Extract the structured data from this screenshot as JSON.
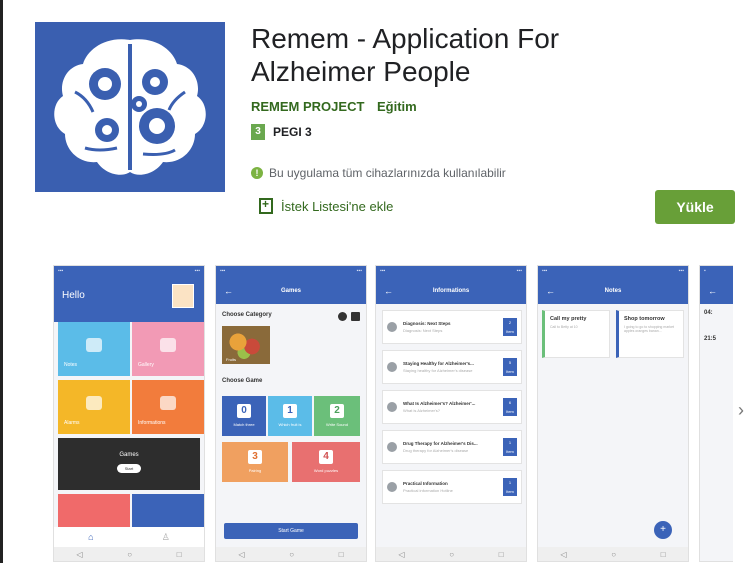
{
  "app": {
    "title": "Remem - Application For Alzheimer People",
    "developer": "REMEM PROJECT",
    "category": "Eğitim",
    "rating_badge": "3",
    "rating_label": "PEGI 3",
    "compatibility": "Bu uygulama tüm cihazlarınızda kullanılabilir",
    "wishlist_label": "İstek Listesi'ne ekle",
    "install_label": "Yükle",
    "icon": "brain-gears-icon"
  },
  "colors": {
    "accent_green": "#689f38",
    "text_green": "#33691e",
    "icon_blue": "#3a5fb0",
    "app_blue": "#3b63b8"
  },
  "screenshots": {
    "home": {
      "greeting": "Hello",
      "tiles": [
        "Notes",
        "Gallery",
        "Alarms",
        "Informations"
      ],
      "games_label": "Games",
      "start_label": "Start"
    },
    "games": {
      "title": "Games",
      "choose_category": "Choose Category",
      "category_label": "Fruits",
      "choose_game": "Choose Game",
      "game_numbers": [
        "0",
        "1",
        "2",
        "3",
        "4"
      ],
      "game_names": [
        "Match three",
        "Which fruit is",
        "Write Sound",
        "Pairing",
        "Word puzzles"
      ],
      "start_game": "Start Game"
    },
    "informations": {
      "title": "Informations",
      "rows": [
        {
          "title": "Diagnosis: Next Steps",
          "subtitle": "Diagnosis: Next Steps",
          "count": "2"
        },
        {
          "title": "Staying Healthy for Alzheimer's...",
          "subtitle": "Staying healthy for Alzheimer's disease",
          "count": "5"
        },
        {
          "title": "What Is Alzheimer's? Alzheimer'...",
          "subtitle": "What is Alzheimer's?",
          "count": "6"
        },
        {
          "title": "Drug Therapy for Alzheimer's Dis...",
          "subtitle": "Drug therapy for Alzheimer's disease",
          "count": "1"
        },
        {
          "title": "Practical Information",
          "subtitle": "Practical information Hotline",
          "count": "1"
        }
      ],
      "count_unit": "Item"
    },
    "notes": {
      "title": "Notes",
      "cards": [
        {
          "title": "Call my pretty",
          "body": "Call to Betty at 10"
        },
        {
          "title": "Shop tomorrow",
          "body": "I going to go to shopping market apples oranges banan..."
        }
      ]
    },
    "partial": {
      "items": [
        "04:",
        "21:5"
      ]
    }
  },
  "nav": {
    "next_label": "›"
  }
}
